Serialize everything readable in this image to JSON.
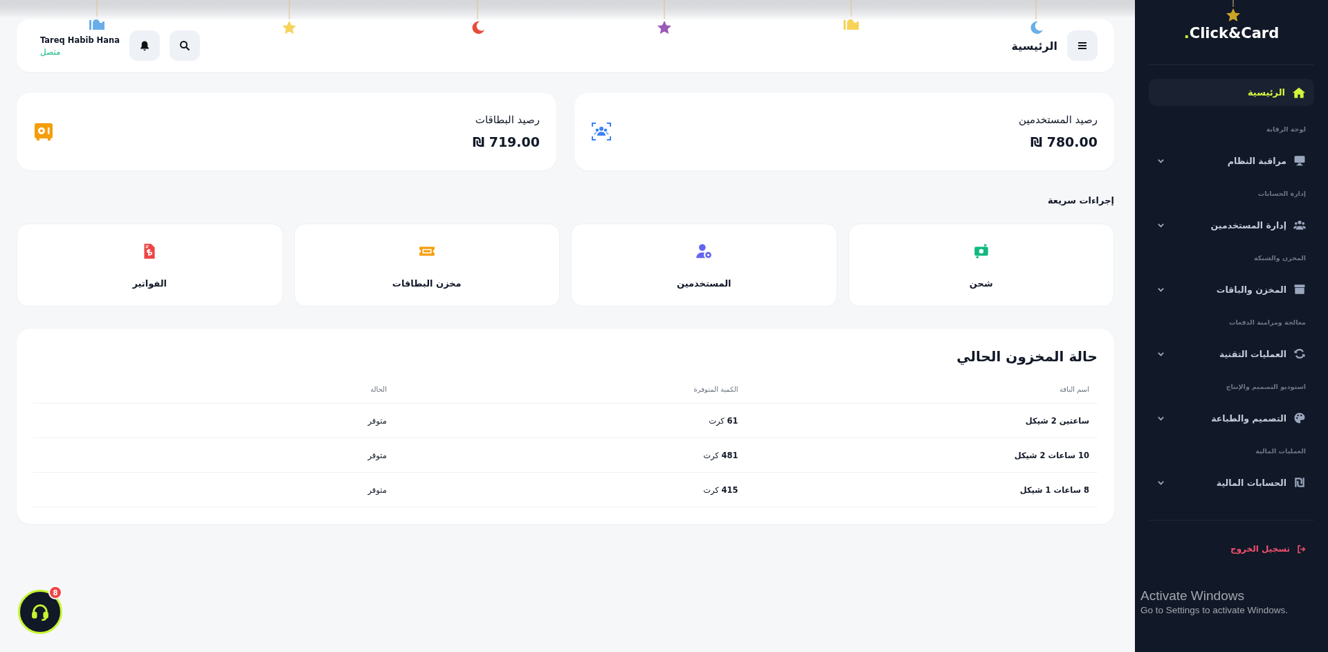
{
  "sidebar": {
    "logo": {
      "dot": ".",
      "text": "Click&Card"
    },
    "home": {
      "label": "الرئيسية",
      "selected": true
    },
    "groups": [
      {
        "section": "لوحة الرقابة",
        "label": "مراقبة النظام",
        "expanded": false
      },
      {
        "section": "إدارة الحسابات",
        "label": "إدارة المستخدمين",
        "expanded": false
      },
      {
        "section": "المخزن والشبكة",
        "label": "المخزن والباقات",
        "expanded": false
      },
      {
        "section": "معالجة ومزامنة الدفعات",
        "label": "العمليات التقنية",
        "expanded": false
      },
      {
        "section": "استوديو التصميم والإنتاج",
        "label": "التصميم والطباعة",
        "expanded": false
      },
      {
        "section": "العمليات المالية",
        "label": "الحسابات المالية",
        "expanded": false
      }
    ],
    "logout": "تسجيل الخروج"
  },
  "header": {
    "title": "الرئيسية",
    "user": {
      "name": "Tareq Habib Hana",
      "status": "متصل"
    }
  },
  "balances": [
    {
      "label": "رصيد المستخدمين",
      "value": "780.00 ₪"
    },
    {
      "label": "رصيد البطاقات",
      "value": "719.00 ₪"
    }
  ],
  "quick_actions": {
    "title": "إجراءات سريعة",
    "items": [
      "شحن",
      "المستخدمين",
      "مخزن البطاقات",
      "الفواتير"
    ]
  },
  "inventory": {
    "title": "حالة المخزون الحالي",
    "columns": [
      "اسم الباقة",
      "الكمية المتوفرة",
      "الحالة"
    ],
    "rows": [
      [
        "ساعتين 2 شيكل",
        "**61** كرت",
        "متوفر"
      ],
      [
        "10 ساعات 2 شيكل",
        "**481** كرت",
        "متوفر"
      ],
      [
        "8 ساعات 1 شيكل",
        "**415** كرت",
        "متوفر"
      ]
    ]
  },
  "support": {
    "badge": "8"
  },
  "os_notice": {
    "title": "Activate Windows",
    "text": "Go to Settings to activate Windows."
  }
}
